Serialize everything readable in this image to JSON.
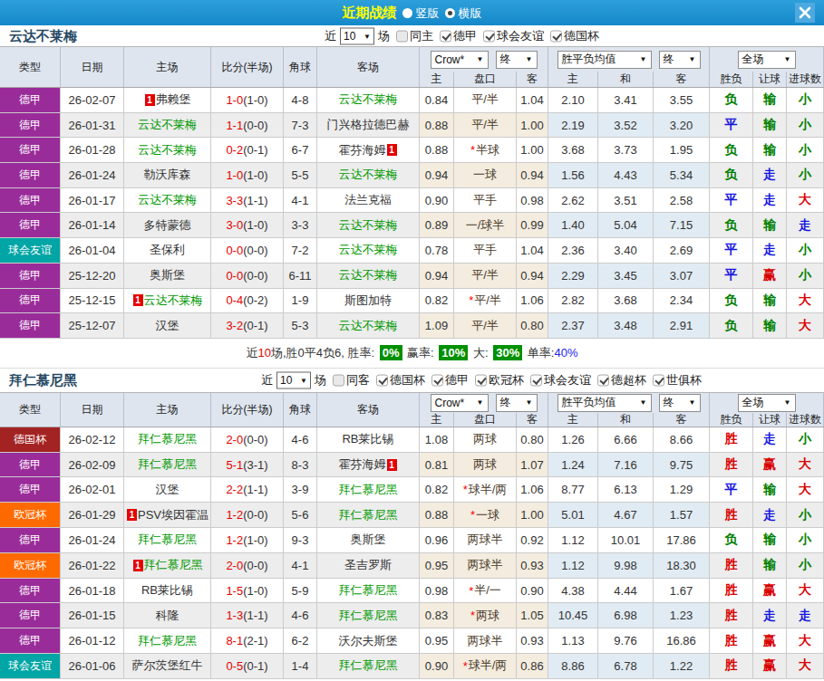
{
  "topbar": {
    "title": "近期战绩",
    "radios": [
      {
        "label": "竖版",
        "selected": false
      },
      {
        "label": "横版",
        "selected": true
      }
    ]
  },
  "table_header": {
    "left": [
      "类型",
      "日期",
      "主场",
      "比分(半场)",
      "角球",
      "客场"
    ],
    "group_selects": [
      [
        "Crow*",
        "终"
      ],
      [
        "胜平负均值",
        "终"
      ],
      [
        "全场"
      ]
    ],
    "sub": [
      "主",
      "盘口",
      "客",
      "主",
      "和",
      "客",
      "胜负",
      "让球",
      "进球数"
    ]
  },
  "colors": {
    "league": {
      "德甲": "#9a2c9a",
      "球会友谊": "#00a5a5",
      "德国杯": "#a32222",
      "欧冠杯": "#ff6a00"
    },
    "outcome": {
      "胜": "#d90000",
      "赢": "#d90000",
      "大": "#d90000",
      "平": "#1515e0",
      "走": "#1515e0",
      "负": "#008000",
      "输": "#008000",
      "小": "#008000"
    },
    "focus_team": "#009900",
    "badge": "1"
  },
  "sections": [
    {
      "team": "云达不莱梅",
      "near_label": "近",
      "games_value": "10",
      "games_label": "场",
      "checkboxes": [
        {
          "label": "同主",
          "checked": false
        },
        {
          "label": "德甲",
          "checked": true
        },
        {
          "label": "球会友谊",
          "checked": true
        },
        {
          "label": "德国杯",
          "checked": true
        }
      ],
      "rows": [
        {
          "league": "德甲",
          "date": "26-02-07",
          "home": "弗赖堡",
          "home_badge": true,
          "home_focus": false,
          "score": "1-0",
          "half": "(1-0)",
          "corner": "4-8",
          "away": "云达不莱梅",
          "away_badge": false,
          "away_focus": true,
          "star": false,
          "odds": [
            "0.84",
            "平/半",
            "1.04"
          ],
          "mean": [
            "2.10",
            "3.41",
            "3.55"
          ],
          "res": [
            "负",
            "输",
            "小"
          ]
        },
        {
          "league": "德甲",
          "date": "26-01-31",
          "home": "云达不莱梅",
          "home_badge": false,
          "home_focus": true,
          "score": "1-1",
          "half": "(0-0)",
          "corner": "7-3",
          "away": "门兴格拉德巴赫",
          "away_badge": false,
          "away_focus": false,
          "star": false,
          "odds": [
            "0.88",
            "平/半",
            "1.00"
          ],
          "mean": [
            "2.19",
            "3.52",
            "3.20"
          ],
          "res": [
            "平",
            "输",
            "小"
          ]
        },
        {
          "league": "德甲",
          "date": "26-01-28",
          "home": "云达不莱梅",
          "home_badge": false,
          "home_focus": true,
          "score": "0-2",
          "half": "(0-1)",
          "corner": "6-7",
          "away": "霍芬海姆",
          "away_badge": true,
          "away_focus": false,
          "star": true,
          "odds": [
            "0.88",
            "半球",
            "1.00"
          ],
          "mean": [
            "3.68",
            "3.73",
            "1.95"
          ],
          "res": [
            "负",
            "输",
            "小"
          ]
        },
        {
          "league": "德甲",
          "date": "26-01-24",
          "home": "勒沃库森",
          "home_badge": false,
          "home_focus": false,
          "score": "1-0",
          "half": "(1-0)",
          "corner": "5-5",
          "away": "云达不莱梅",
          "away_badge": false,
          "away_focus": true,
          "star": false,
          "odds": [
            "0.94",
            "一球",
            "0.94"
          ],
          "mean": [
            "1.56",
            "4.43",
            "5.34"
          ],
          "res": [
            "负",
            "走",
            "小"
          ]
        },
        {
          "league": "德甲",
          "date": "26-01-17",
          "home": "云达不莱梅",
          "home_badge": false,
          "home_focus": true,
          "score": "3-3",
          "half": "(1-1)",
          "corner": "4-1",
          "away": "法兰克福",
          "away_badge": false,
          "away_focus": false,
          "star": false,
          "odds": [
            "0.90",
            "平手",
            "0.98"
          ],
          "mean": [
            "2.62",
            "3.51",
            "2.58"
          ],
          "res": [
            "平",
            "走",
            "大"
          ]
        },
        {
          "league": "德甲",
          "date": "26-01-14",
          "home": "多特蒙德",
          "home_badge": false,
          "home_focus": false,
          "score": "3-0",
          "half": "(1-0)",
          "corner": "3-3",
          "away": "云达不莱梅",
          "away_badge": false,
          "away_focus": true,
          "star": false,
          "odds": [
            "0.89",
            "一/球半",
            "0.99"
          ],
          "mean": [
            "1.40",
            "5.04",
            "7.15"
          ],
          "res": [
            "负",
            "输",
            "走"
          ]
        },
        {
          "league": "球会友谊",
          "date": "26-01-04",
          "home": "圣保利",
          "home_badge": false,
          "home_focus": false,
          "score": "0-0",
          "half": "(0-0)",
          "corner": "7-2",
          "away": "云达不莱梅",
          "away_badge": false,
          "away_focus": true,
          "star": false,
          "odds": [
            "0.78",
            "平手",
            "1.04"
          ],
          "mean": [
            "2.36",
            "3.40",
            "2.69"
          ],
          "res": [
            "平",
            "走",
            "小"
          ]
        },
        {
          "league": "德甲",
          "date": "25-12-20",
          "home": "奥斯堡",
          "home_badge": false,
          "home_focus": false,
          "score": "0-0",
          "half": "(0-0)",
          "corner": "6-11",
          "away": "云达不莱梅",
          "away_badge": false,
          "away_focus": true,
          "star": false,
          "odds": [
            "0.94",
            "平/半",
            "0.94"
          ],
          "mean": [
            "2.29",
            "3.45",
            "3.07"
          ],
          "res": [
            "平",
            "赢",
            "小"
          ]
        },
        {
          "league": "德甲",
          "date": "25-12-15",
          "home": "云达不莱梅",
          "home_badge": true,
          "home_focus": true,
          "score": "0-4",
          "half": "(0-2)",
          "corner": "1-9",
          "away": "斯图加特",
          "away_badge": false,
          "away_focus": false,
          "star": true,
          "odds": [
            "0.82",
            "平/半",
            "1.06"
          ],
          "mean": [
            "2.82",
            "3.68",
            "2.34"
          ],
          "res": [
            "负",
            "输",
            "大"
          ]
        },
        {
          "league": "德甲",
          "date": "25-12-07",
          "home": "汉堡",
          "home_badge": false,
          "home_focus": false,
          "score": "3-2",
          "half": "(0-1)",
          "corner": "5-3",
          "away": "云达不莱梅",
          "away_badge": false,
          "away_focus": true,
          "star": false,
          "odds": [
            "1.09",
            "平/半",
            "0.80"
          ],
          "mean": [
            "2.37",
            "3.48",
            "2.91"
          ],
          "res": [
            "负",
            "输",
            "大"
          ]
        }
      ],
      "summary": {
        "prefix": "近",
        "count": "10",
        "mid": "场,胜0平4负6, 胜率: ",
        "rate_badge": "0%",
        "win_label": " 赢率: ",
        "win_badge": "10%",
        "big_label": " 大: ",
        "big_badge": "30%",
        "single_label": " 单率:",
        "single_value": "40%"
      }
    },
    {
      "team": "拜仁慕尼黑",
      "near_label": "近",
      "games_value": "10",
      "games_label": "场",
      "checkboxes": [
        {
          "label": "同客",
          "checked": false
        },
        {
          "label": "德国杯",
          "checked": true
        },
        {
          "label": "德甲",
          "checked": true
        },
        {
          "label": "欧冠杯",
          "checked": true
        },
        {
          "label": "球会友谊",
          "checked": true
        },
        {
          "label": "德超杯",
          "checked": true
        },
        {
          "label": "世俱杯",
          "checked": true
        }
      ],
      "rows": [
        {
          "league": "德国杯",
          "date": "26-02-12",
          "home": "拜仁慕尼黑",
          "home_badge": false,
          "home_focus": true,
          "score": "2-0",
          "half": "(0-0)",
          "corner": "4-6",
          "away": "RB莱比锡",
          "away_badge": false,
          "away_focus": false,
          "star": false,
          "odds": [
            "1.08",
            "两球",
            "0.80"
          ],
          "mean": [
            "1.26",
            "6.66",
            "8.66"
          ],
          "res": [
            "胜",
            "走",
            "小"
          ]
        },
        {
          "league": "德甲",
          "date": "26-02-09",
          "home": "拜仁慕尼黑",
          "home_badge": false,
          "home_focus": true,
          "score": "5-1",
          "half": "(3-1)",
          "corner": "8-3",
          "away": "霍芬海姆",
          "away_badge": true,
          "away_focus": false,
          "star": false,
          "odds": [
            "0.81",
            "两球",
            "1.07"
          ],
          "mean": [
            "1.24",
            "7.16",
            "9.75"
          ],
          "res": [
            "胜",
            "赢",
            "大"
          ]
        },
        {
          "league": "德甲",
          "date": "26-02-01",
          "home": "汉堡",
          "home_badge": false,
          "home_focus": false,
          "score": "2-2",
          "half": "(1-1)",
          "corner": "3-9",
          "away": "拜仁慕尼黑",
          "away_badge": false,
          "away_focus": true,
          "star": true,
          "odds": [
            "0.82",
            "球半/两",
            "1.06"
          ],
          "mean": [
            "8.77",
            "6.13",
            "1.29"
          ],
          "res": [
            "平",
            "输",
            "大"
          ]
        },
        {
          "league": "欧冠杯",
          "date": "26-01-29",
          "home": "PSV埃因霍温",
          "home_badge": true,
          "home_focus": false,
          "score": "1-2",
          "half": "(0-0)",
          "corner": "5-6",
          "away": "拜仁慕尼黑",
          "away_badge": false,
          "away_focus": true,
          "star": true,
          "odds": [
            "0.88",
            "一球",
            "1.00"
          ],
          "mean": [
            "5.01",
            "4.67",
            "1.57"
          ],
          "res": [
            "胜",
            "走",
            "小"
          ]
        },
        {
          "league": "德甲",
          "date": "26-01-24",
          "home": "拜仁慕尼黑",
          "home_badge": false,
          "home_focus": true,
          "score": "1-2",
          "half": "(1-0)",
          "corner": "9-3",
          "away": "奥斯堡",
          "away_badge": false,
          "away_focus": false,
          "star": false,
          "odds": [
            "0.96",
            "两球半",
            "0.92"
          ],
          "mean": [
            "1.12",
            "10.01",
            "17.86"
          ],
          "res": [
            "负",
            "输",
            "小"
          ]
        },
        {
          "league": "欧冠杯",
          "date": "26-01-22",
          "home": "拜仁慕尼黑",
          "home_badge": true,
          "home_focus": true,
          "score": "2-0",
          "half": "(0-0)",
          "corner": "4-1",
          "away": "圣吉罗斯",
          "away_badge": false,
          "away_focus": false,
          "star": false,
          "odds": [
            "0.95",
            "两球半",
            "0.93"
          ],
          "mean": [
            "1.12",
            "9.98",
            "18.30"
          ],
          "res": [
            "胜",
            "输",
            "小"
          ]
        },
        {
          "league": "德甲",
          "date": "26-01-18",
          "home": "RB莱比锡",
          "home_badge": false,
          "home_focus": false,
          "score": "1-5",
          "half": "(1-0)",
          "corner": "5-9",
          "away": "拜仁慕尼黑",
          "away_badge": false,
          "away_focus": true,
          "star": true,
          "odds": [
            "0.98",
            "半/一",
            "0.90"
          ],
          "mean": [
            "4.38",
            "4.44",
            "1.67"
          ],
          "res": [
            "胜",
            "赢",
            "大"
          ]
        },
        {
          "league": "德甲",
          "date": "26-01-15",
          "home": "科隆",
          "home_badge": false,
          "home_focus": false,
          "score": "1-3",
          "half": "(1-1)",
          "corner": "4-6",
          "away": "拜仁慕尼黑",
          "away_badge": false,
          "away_focus": true,
          "star": true,
          "odds": [
            "0.83",
            "两球",
            "1.05"
          ],
          "mean": [
            "10.45",
            "6.98",
            "1.23"
          ],
          "res": [
            "胜",
            "走",
            "走"
          ]
        },
        {
          "league": "德甲",
          "date": "26-01-12",
          "home": "拜仁慕尼黑",
          "home_badge": false,
          "home_focus": true,
          "score": "8-1",
          "half": "(2-1)",
          "corner": "6-2",
          "away": "沃尔夫斯堡",
          "away_badge": false,
          "away_focus": false,
          "star": false,
          "odds": [
            "0.95",
            "两球半",
            "0.93"
          ],
          "mean": [
            "1.13",
            "9.76",
            "16.86"
          ],
          "res": [
            "胜",
            "赢",
            "大"
          ]
        },
        {
          "league": "球会友谊",
          "date": "26-01-06",
          "home": "萨尔茨堡红牛",
          "home_badge": false,
          "home_focus": false,
          "score": "0-5",
          "half": "(0-1)",
          "corner": "1-4",
          "away": "拜仁慕尼黑",
          "away_badge": false,
          "away_focus": true,
          "star": true,
          "odds": [
            "0.90",
            "球半/两",
            "0.86"
          ],
          "mean": [
            "8.86",
            "6.78",
            "1.22"
          ],
          "res": [
            "胜",
            "赢",
            "大"
          ]
        }
      ]
    }
  ]
}
